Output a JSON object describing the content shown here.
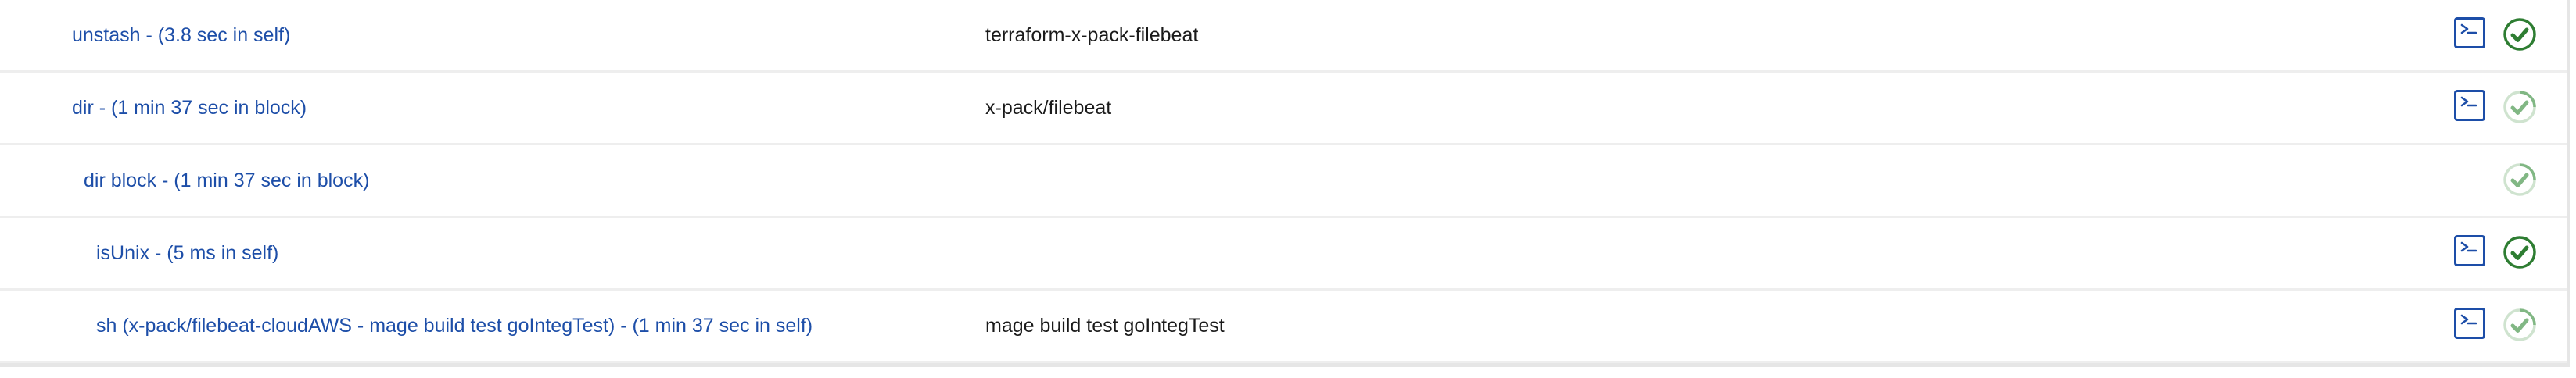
{
  "steps": [
    {
      "label": "unstash - (3.8 sec in self)",
      "argument": "terraform-x-pack-filebeat",
      "has_console": true,
      "status_icon": "success-check-icon",
      "status_style": "solid"
    },
    {
      "label": "dir - (1 min 37 sec in block)",
      "argument": "x-pack/filebeat",
      "has_console": true,
      "status_icon": "success-check-icon",
      "status_style": "light"
    },
    {
      "label": "dir block - (1 min 37 sec in block)",
      "argument": "",
      "has_console": false,
      "status_icon": "success-check-icon",
      "status_style": "light"
    },
    {
      "label": "isUnix - (5 ms in self)",
      "argument": "",
      "has_console": true,
      "status_icon": "success-check-icon",
      "status_style": "solid"
    },
    {
      "label": "sh (x-pack/filebeat-cloudAWS - mage build test goIntegTest) - (1 min 37 sec in self)",
      "argument": "mage build test goIntegTest",
      "has_console": true,
      "status_icon": "success-check-icon",
      "status_style": "light"
    }
  ],
  "colors": {
    "link": "#1d4ea8",
    "success_solid": "#2e7d32",
    "success_light": "#81b784",
    "console_border": "#1d4ea8"
  },
  "icons": {
    "console": "terminal-icon",
    "status": "success-check-icon"
  }
}
